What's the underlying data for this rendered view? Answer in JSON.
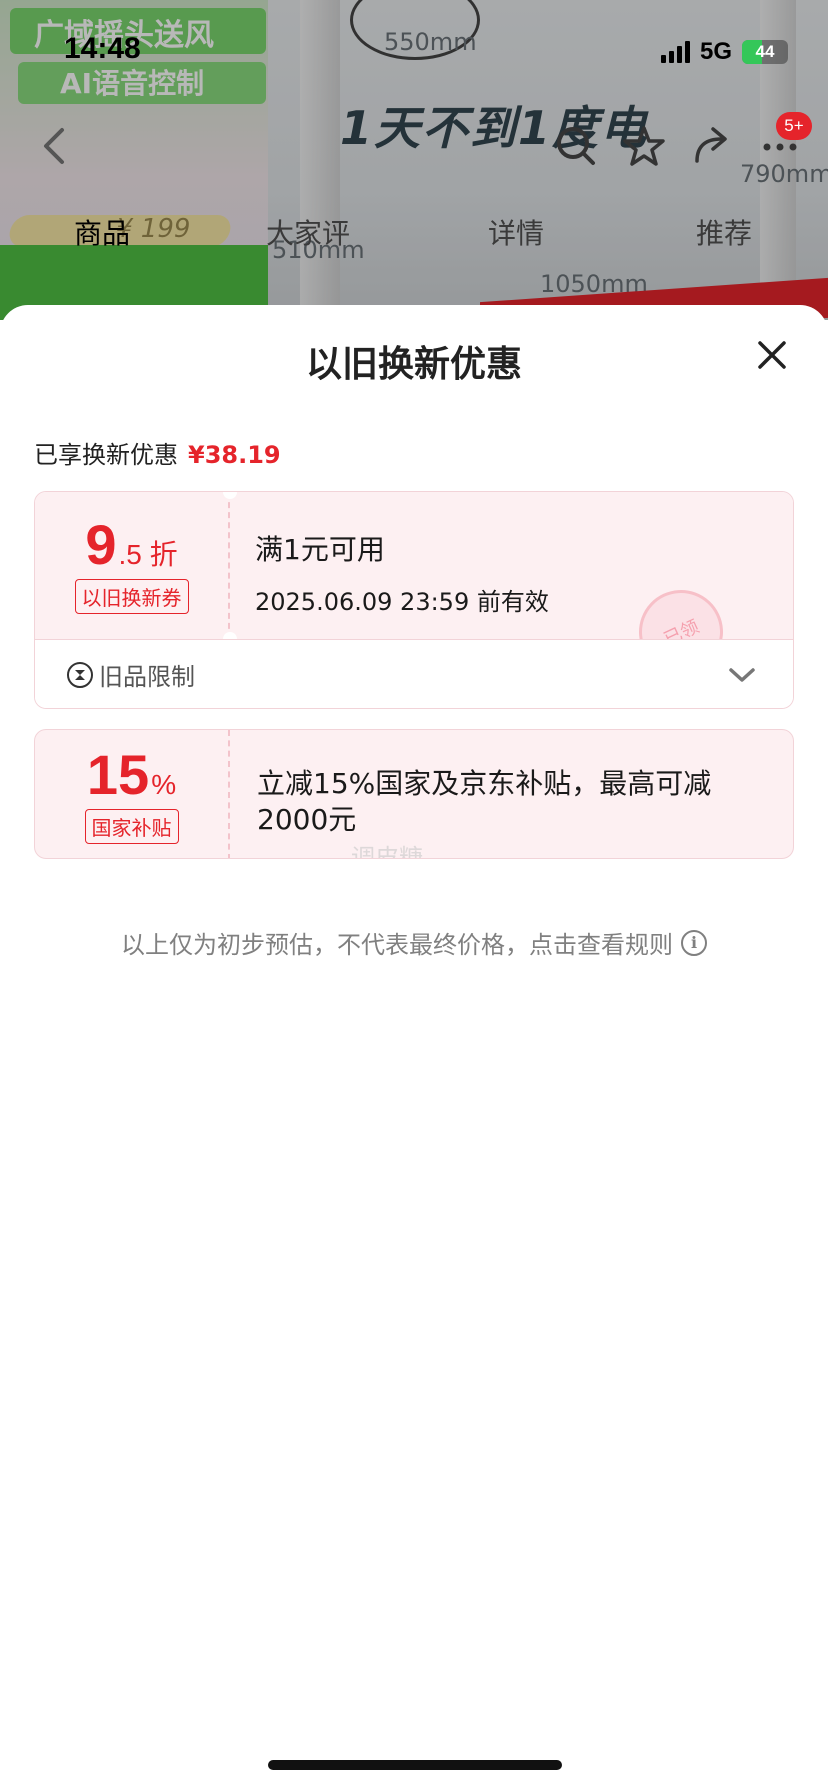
{
  "status_bar": {
    "time": "14:48",
    "network": "5G",
    "battery": "44"
  },
  "background": {
    "tag1": "广域摇头送风",
    "tag2": "AI语音控制",
    "price": "¥ 199",
    "slogan": "1天不到1度电",
    "dims": [
      "550mm",
      "790mm",
      "510mm",
      "1050mm"
    ],
    "cart_badge": "5+"
  },
  "tabs": [
    "商品",
    "大家评",
    "详情",
    "推荐"
  ],
  "sheet": {
    "title": "以旧换新优惠",
    "enjoyed_label": "已享换新优惠",
    "enjoyed_amount": "¥38.19"
  },
  "coupon1": {
    "discount_int": "9",
    "discount_suffix": ".5 折",
    "tag": "以旧换新券",
    "condition": "满1元可用",
    "valid_until": "2025.06.09 23:59 前有效",
    "stamp": "已领",
    "restriction_label": "旧品限制"
  },
  "coupon2": {
    "value": "15",
    "unit": "%",
    "tag": "国家补贴",
    "description": "立减15%国家及京东补贴，最高可减 2000元",
    "watermark": "调皮糖"
  },
  "footnote": "以上仅为初步预估，不代表最终价格，点击查看规则"
}
